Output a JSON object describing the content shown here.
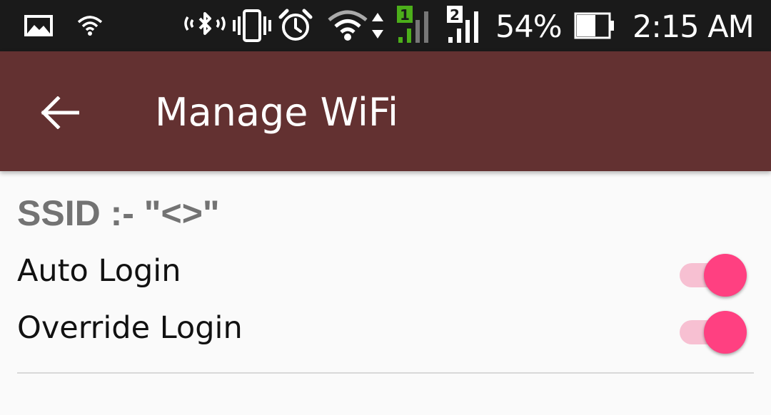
{
  "status_bar": {
    "battery_percent": "54%",
    "time": "2:15 AM",
    "sim1_label": "1",
    "sim2_label": "2",
    "icons": [
      "image-icon",
      "wifi-small-icon",
      "bluetooth-icon",
      "vibrate-icon",
      "alarm-icon",
      "wifi-icon",
      "data-arrows-icon",
      "signal-sim1-icon",
      "signal-sim2-icon",
      "battery-icon"
    ]
  },
  "app_bar": {
    "title": "Manage WiFi",
    "back_icon": "arrow-back-icon"
  },
  "content": {
    "ssid_label": "SSID :- \"<>\"",
    "settings": [
      {
        "label": "Auto Login",
        "enabled": true
      },
      {
        "label": "Override Login",
        "enabled": true
      }
    ]
  },
  "colors": {
    "app_bar": "#633131",
    "status_bar": "#1a1a1a",
    "accent": "#ff4081",
    "switch_track": "#f7c0d2",
    "background": "#fafafa",
    "sim1_highlight": "#4caf1a"
  }
}
